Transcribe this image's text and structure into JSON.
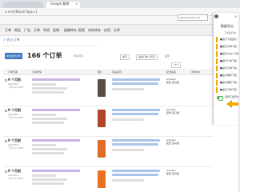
{
  "browser": {
    "tab_title": "Google 翻译",
    "url": "u.com/Barai/?pgs=1"
  },
  "store_select": "store.amazon.de",
  "nav": {
    "items": [
      "订单",
      "商品",
      "广告",
      "订单",
      "利润",
      "促销",
      "配额库存",
      "报表",
      "实际库存",
      "应用",
      "分享"
    ]
  },
  "breadcrumb": "> 网上订单",
  "toolbar": {
    "export_label": "导出配送文件",
    "order_count": "166 个订单",
    "filter_label": "所有时间",
    "sort_label": "排序",
    "status_label": "最新订单 (升序)",
    "page_label": "显示",
    "page_size": "20 ▾"
  },
  "table": {
    "headers": [
      "订单日期",
      "订单详情",
      "图片",
      "商品名称",
      "配送渠道",
      "订单状态"
    ],
    "rows": [
      {
        "date": "9 个月前",
        "meta": "2020/6/1\n下午4:10 PDT",
        "channel": "Amazon\n配送 亚马逊"
      },
      {
        "date": "9 个月前",
        "meta": "2020/6/1\n下午2:56 PDT",
        "channel": "Amazon\n配送 亚马逊"
      },
      {
        "date": "9 个月前",
        "meta": "2020/6/1\n下午1:17 PDT",
        "channel": "Amazon\n配送 亚马逊"
      },
      {
        "date": "9 个月前",
        "meta": "2020/6/1\n下午1:16 PDT",
        "channel": "Amazon\n配送 亚马逊"
      }
    ]
  },
  "panel": {
    "title": "数据导出",
    "hint": "下载运行中...",
    "items": [
      "■运行下载运行",
      "■运行订单下载",
      "■运行Sales下载",
      "■运行广告下载",
      "■运行订单下载",
      "■运行库存下载",
      "■运行库存下载",
      "■运行订单下载"
    ],
    "auto_label": "自动下载开关"
  },
  "colors": {
    "accent": "#3a78c2",
    "highlight": "#f0a500",
    "toggle_on": "#4caf50"
  }
}
